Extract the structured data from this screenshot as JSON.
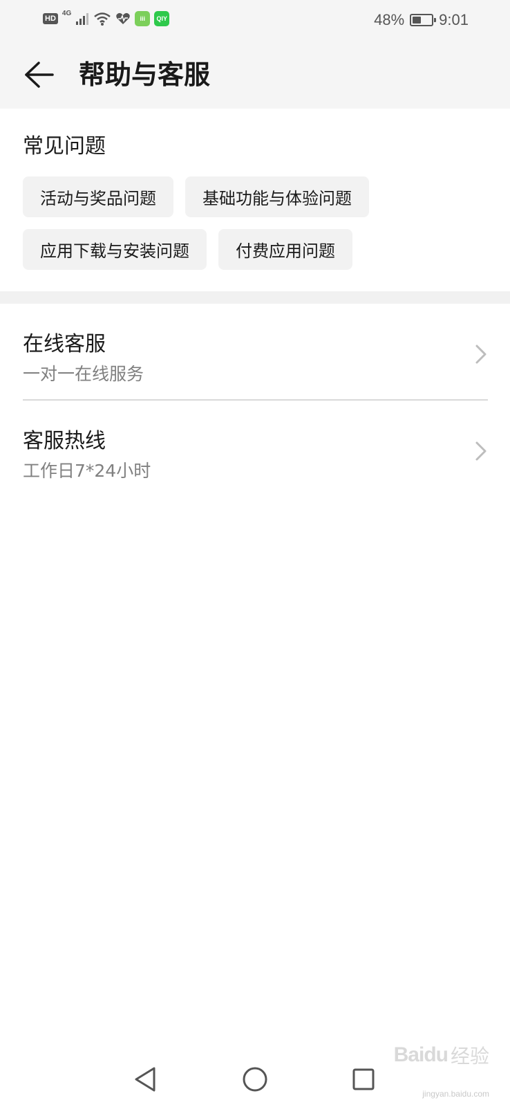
{
  "status_bar": {
    "hd": "HD",
    "network": "4G",
    "app_badge_1": "iii",
    "app_badge_2": "QIY",
    "battery_percent": "48%",
    "battery_level": 0.48,
    "time": "9:01",
    "icons": [
      "signal-icon",
      "wifi-icon",
      "health-icon"
    ]
  },
  "header": {
    "back_icon": "arrow-left-icon",
    "title": "帮助与客服"
  },
  "faq": {
    "title": "常见问题",
    "chips": [
      [
        "活动与奖品问题",
        "基础功能与体验问题"
      ],
      [
        "应用下载与安装问题",
        "付费应用问题"
      ]
    ]
  },
  "list": [
    {
      "title": "在线客服",
      "subtitle": "一对一在线服务",
      "icon": "chevron-right-icon"
    },
    {
      "title": "客服热线",
      "subtitle": "工作日7*24小时",
      "icon": "chevron-right-icon"
    }
  ],
  "nav_bar": {
    "icons": [
      "back-triangle-icon",
      "home-circle-icon",
      "recents-square-icon"
    ]
  },
  "watermark": {
    "logo": "Bai",
    "logo_suffix": "du",
    "text": "经验",
    "url": "jingyan.baidu.com"
  },
  "colors": {
    "header_bg": "#f5f5f5",
    "chip_bg": "#f2f2f2",
    "divider": "#d9d9d9",
    "subtitle": "#808080"
  }
}
